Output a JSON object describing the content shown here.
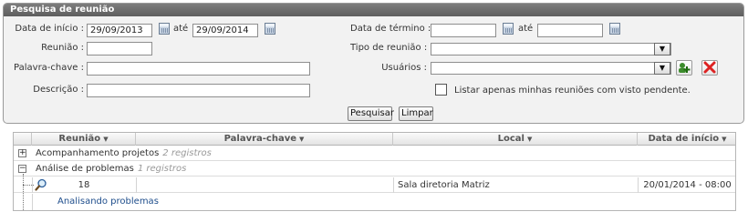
{
  "panel": {
    "title": "Pesquisa de reunião"
  },
  "form": {
    "data_inicio_label": "Data de início :",
    "data_inicio_value": "29/09/2013",
    "ate_label": "até",
    "data_inicio_ate_value": "29/09/2014",
    "data_termino_label": "Data de término :",
    "data_termino_value": "",
    "data_termino_ate_value": "",
    "reuniao_label": "Reunião :",
    "reuniao_value": "",
    "tipo_label": "Tipo de reunião :",
    "tipo_selected": "",
    "palavra_label": "Palavra-chave :",
    "palavra_value": "",
    "usuarios_label": "Usuários :",
    "usuarios_selected": "",
    "descricao_label": "Descrição :",
    "descricao_value": "",
    "checkbox_label": "Listar apenas minhas reuniões com visto pendente.",
    "checkbox_checked": false
  },
  "buttons": {
    "pesquisar": "Pesquisar",
    "limpar": "Limpar"
  },
  "grid": {
    "columns": [
      "Reunião",
      "Palavra-chave",
      "Local",
      "Data de início"
    ],
    "groups": [
      {
        "label": "Acompanhamento projetos",
        "count": "2 registros",
        "expanded": false
      },
      {
        "label": "Análise de problemas",
        "count": "1 registros",
        "expanded": true
      }
    ],
    "rows": [
      {
        "reuniao": "18",
        "palavra_chave": "",
        "local": "Sala diretoria Matriz",
        "data_inicio": "20/01/2014 - 08:00",
        "description": "Analisando problemas"
      }
    ]
  }
}
